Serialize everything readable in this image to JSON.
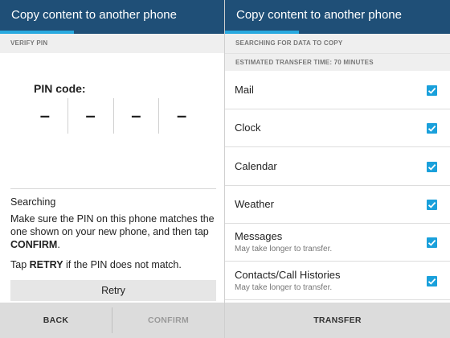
{
  "left": {
    "title": "Copy content to another phone",
    "progress": 0.33,
    "section_header": "VERIFY PIN",
    "pin_label": "PIN code:",
    "pin_digits": [
      "–",
      "–",
      "–",
      "–"
    ],
    "status": "Searching",
    "instruction": {
      "prefix": "Make sure the PIN on this phone matches the one shown on your new phone, and then tap ",
      "emphasis": "CONFIRM",
      "suffix": "."
    },
    "retry_hint": {
      "prefix": "Tap ",
      "emphasis": "RETRY",
      "suffix": " if the PIN does not match."
    },
    "retry_label": "Retry",
    "back_label": "BACK",
    "confirm_label": "CONFIRM"
  },
  "right": {
    "title": "Copy content to another phone",
    "progress": 0.33,
    "section_header": "SEARCHING FOR DATA TO COPY",
    "estimate": "ESTIMATED TRANSFER TIME: 70 MINUTES",
    "items": [
      {
        "label": "Mail",
        "sub": "",
        "checked": true
      },
      {
        "label": "Clock",
        "sub": "",
        "checked": true
      },
      {
        "label": "Calendar",
        "sub": "",
        "checked": true
      },
      {
        "label": "Weather",
        "sub": "",
        "checked": true
      },
      {
        "label": "Messages",
        "sub": "May take longer to transfer.",
        "checked": true
      },
      {
        "label": "Contacts/Call Histories",
        "sub": "May take longer to transfer.",
        "checked": true
      }
    ],
    "transfer_label": "TRANSFER"
  },
  "colors": {
    "appbar": "#1f4f77",
    "progress": "#29a9df",
    "checkbox": "#1aa0db"
  }
}
